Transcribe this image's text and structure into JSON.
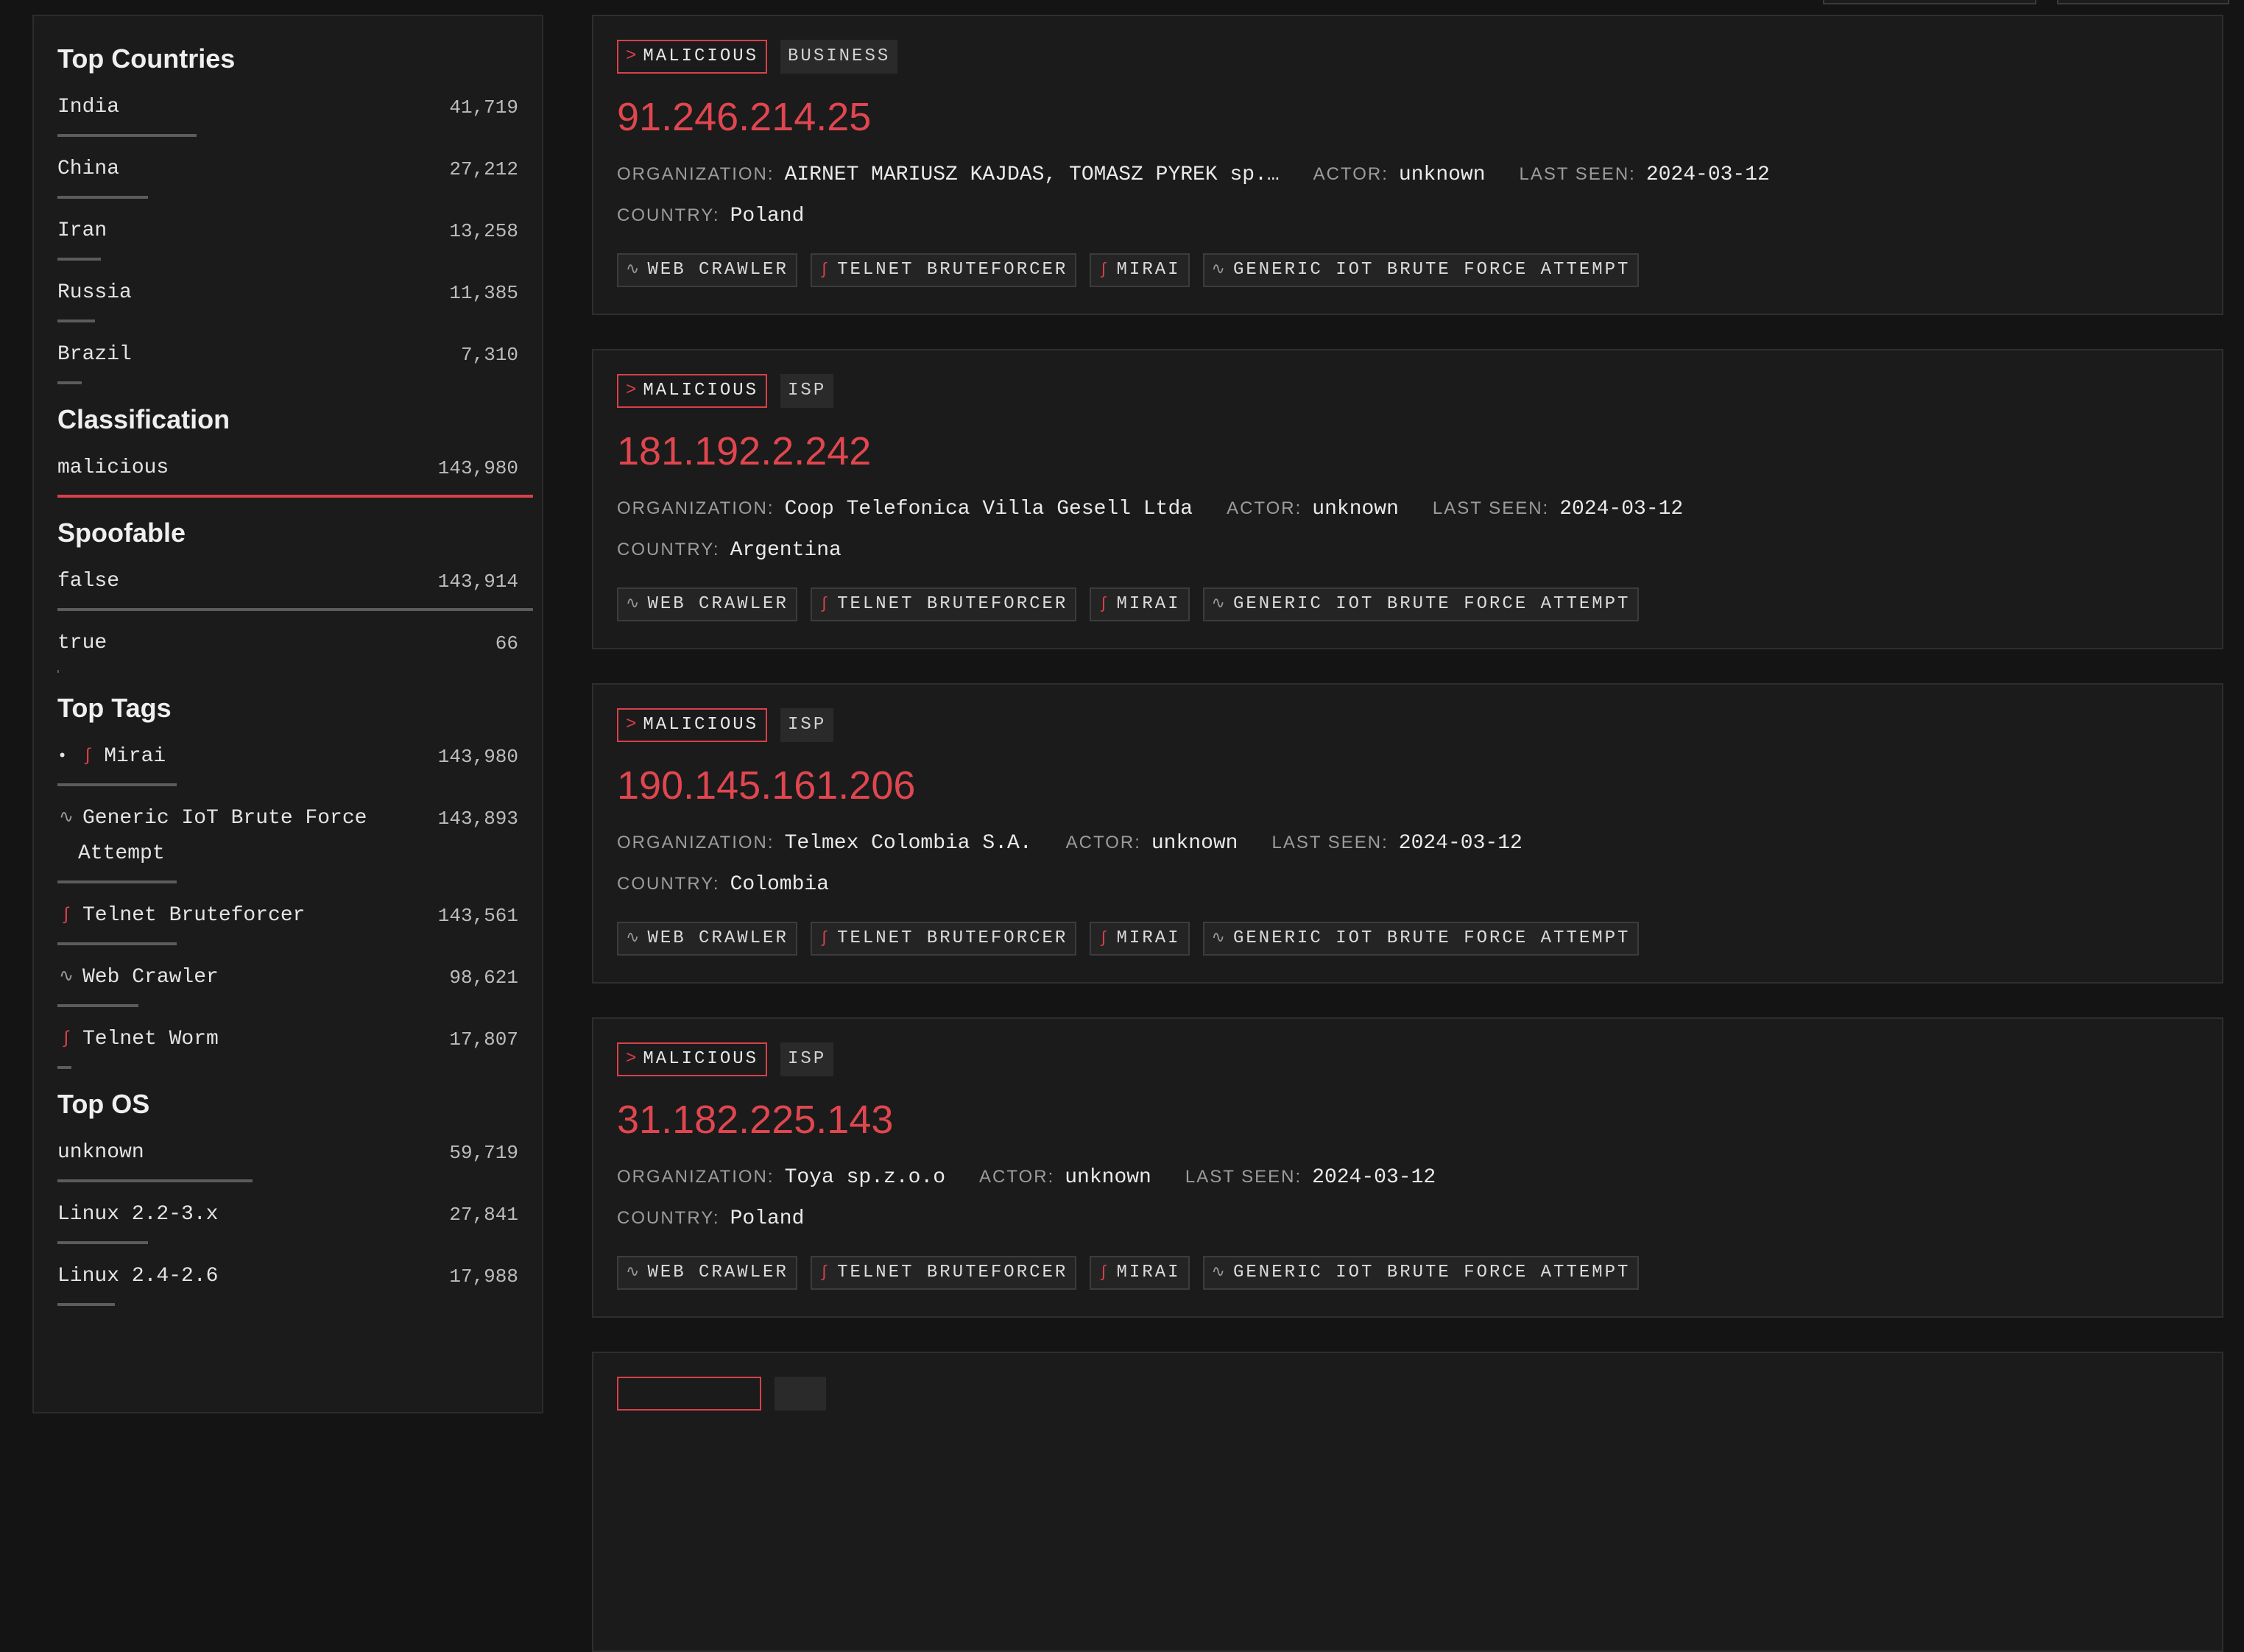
{
  "sidebar": {
    "top_countries": {
      "title": "Top Countries",
      "items": [
        {
          "label": "India",
          "value": "41,719",
          "fraction": 0.292
        },
        {
          "label": "China",
          "value": "27,212",
          "fraction": 0.19
        },
        {
          "label": "Iran",
          "value": "13,258",
          "fraction": 0.092
        },
        {
          "label": "Russia",
          "value": "11,385",
          "fraction": 0.079
        },
        {
          "label": "Brazil",
          "value": "7,310",
          "fraction": 0.051
        }
      ]
    },
    "classification": {
      "title": "Classification",
      "items": [
        {
          "label": "malicious",
          "value": "143,980",
          "fraction": 1.0
        }
      ]
    },
    "spoofable": {
      "title": "Spoofable",
      "items": [
        {
          "label": "false",
          "value": "143,914",
          "fraction": 0.9995
        },
        {
          "label": "true",
          "value": "66",
          "fraction": 0.0005
        }
      ]
    },
    "top_tags": {
      "title": "Top Tags",
      "items": [
        {
          "label": "Mirai",
          "value": "143,980",
          "icon": "worm-icon",
          "fraction": 0.25
        },
        {
          "label": "Generic IoT Brute Force",
          "label2": "Attempt",
          "value": "143,893",
          "icon": "pulse-icon",
          "fraction": 0.25
        },
        {
          "label": "Telnet Bruteforcer",
          "value": "143,561",
          "icon": "worm-icon",
          "fraction": 0.25
        },
        {
          "label": "Web Crawler",
          "value": "98,621",
          "icon": "pulse-icon",
          "fraction": 0.17
        },
        {
          "label": "Telnet Worm",
          "value": "17,807",
          "icon": "worm-icon",
          "fraction": 0.03
        }
      ]
    },
    "top_os": {
      "title": "Top OS",
      "items": [
        {
          "label": "unknown",
          "value": "59,719",
          "fraction": 0.41
        },
        {
          "label": "Linux 2.2-3.x",
          "value": "27,841",
          "fraction": 0.19
        },
        {
          "label": "Linux 2.4-2.6",
          "value": "17,988",
          "fraction": 0.12
        }
      ]
    }
  },
  "labels": {
    "organization": "ORGANIZATION:",
    "actor": "ACTOR:",
    "last_seen": "LAST SEEN:",
    "country": "COUNTRY:"
  },
  "results": [
    {
      "classification": "MALICIOUS",
      "type": "BUSINESS",
      "ip": "91.246.214.25",
      "organization": "AIRNET MARIUSZ KAJDAS, TOMASZ PYREK sp.…",
      "actor": "unknown",
      "last_seen": "2024-03-12",
      "country": "Poland",
      "tags": [
        {
          "label": "WEB CRAWLER",
          "icon": "pulse-icon"
        },
        {
          "label": "TELNET BRUTEFORCER",
          "icon": "worm-icon"
        },
        {
          "label": "MIRAI",
          "icon": "worm-icon"
        },
        {
          "label": "GENERIC IOT BRUTE FORCE ATTEMPT",
          "icon": "pulse-icon"
        }
      ]
    },
    {
      "classification": "MALICIOUS",
      "type": "ISP",
      "ip": "181.192.2.242",
      "organization": "Coop Telefonica Villa Gesell Ltda",
      "actor": "unknown",
      "last_seen": "2024-03-12",
      "country": "Argentina",
      "tags": [
        {
          "label": "WEB CRAWLER",
          "icon": "pulse-icon"
        },
        {
          "label": "TELNET BRUTEFORCER",
          "icon": "worm-icon"
        },
        {
          "label": "MIRAI",
          "icon": "worm-icon"
        },
        {
          "label": "GENERIC IOT BRUTE FORCE ATTEMPT",
          "icon": "pulse-icon"
        }
      ]
    },
    {
      "classification": "MALICIOUS",
      "type": "ISP",
      "ip": "190.145.161.206",
      "organization": "Telmex Colombia S.A.",
      "actor": "unknown",
      "last_seen": "2024-03-12",
      "country": "Colombia",
      "tags": [
        {
          "label": "WEB CRAWLER",
          "icon": "pulse-icon"
        },
        {
          "label": "TELNET BRUTEFORCER",
          "icon": "worm-icon"
        },
        {
          "label": "MIRAI",
          "icon": "worm-icon"
        },
        {
          "label": "GENERIC IOT BRUTE FORCE ATTEMPT",
          "icon": "pulse-icon"
        }
      ]
    },
    {
      "classification": "MALICIOUS",
      "type": "ISP",
      "ip": "31.182.225.143",
      "organization": "Toya sp.z.o.o",
      "actor": "unknown",
      "last_seen": "2024-03-12",
      "country": "Poland",
      "tags": [
        {
          "label": "WEB CRAWLER",
          "icon": "pulse-icon"
        },
        {
          "label": "TELNET BRUTEFORCER",
          "icon": "worm-icon"
        },
        {
          "label": "MIRAI",
          "icon": "worm-icon"
        },
        {
          "label": "GENERIC IOT BRUTE FORCE ATTEMPT",
          "icon": "pulse-icon"
        }
      ]
    }
  ],
  "colors": {
    "accent": "#d8404a",
    "background": "#141414",
    "panel": "#1b1b1b"
  }
}
